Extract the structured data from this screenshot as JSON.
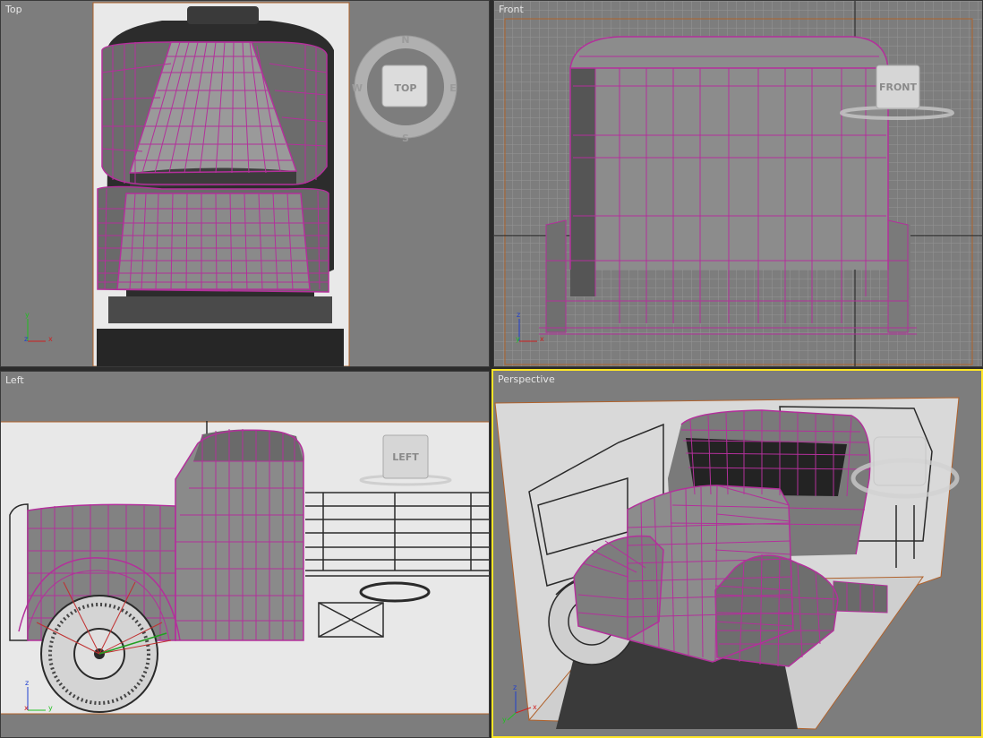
{
  "viewports": {
    "top": {
      "label": "Top",
      "cube": "TOP",
      "compass": {
        "n": "N",
        "s": "S",
        "e": "E",
        "w": "W"
      },
      "axes": {
        "vertical": "y",
        "horizontal": "x",
        "origin": "z"
      }
    },
    "front": {
      "label": "Front",
      "cube": "FRONT",
      "axes": {
        "vertical": "z",
        "horizontal": "x",
        "origin": "y"
      }
    },
    "left": {
      "label": "Left",
      "cube": "LEFT",
      "axes": {
        "vertical": "z",
        "horizontal": "y",
        "origin": "x"
      }
    },
    "perspective": {
      "label": "Perspective",
      "active": true,
      "axes": {
        "vertical": "z",
        "horizontal": "x",
        "origin": "y"
      }
    }
  },
  "colors": {
    "viewport_bg": "#7d7d7d",
    "wireframe": "#b3309b",
    "active_border": "#ffe627",
    "frame_orange": "#b0622c",
    "axis_x": "#d02020",
    "axis_y": "#20c020",
    "axis_z": "#2040d0"
  }
}
